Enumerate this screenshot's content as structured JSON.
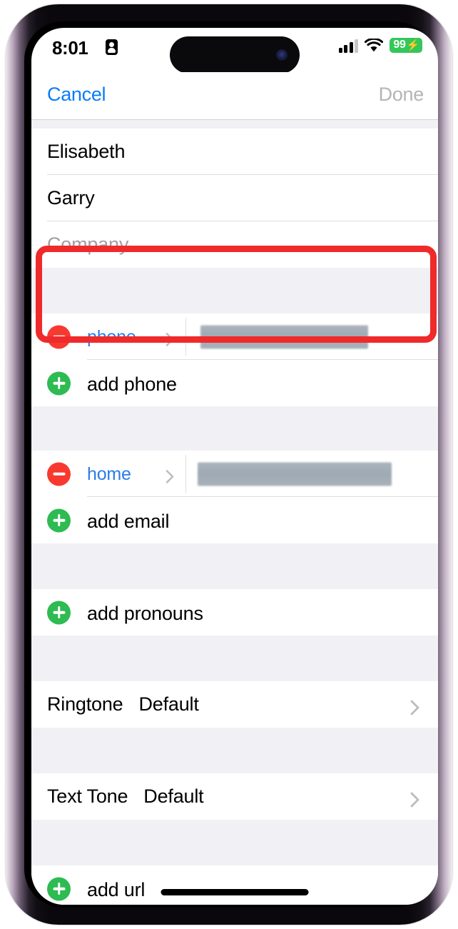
{
  "status_bar": {
    "time": "8:01",
    "id_icon": "contact-card-icon",
    "signal_icon": "cellular-signal-icon",
    "wifi_icon": "wifi-icon",
    "battery_level": "99",
    "battery_charging_glyph": "⚡",
    "battery_color": "#34c759"
  },
  "nav": {
    "cancel_label": "Cancel",
    "done_label": "Done",
    "cancel_color": "#0a7cf6",
    "done_color": "#b4b4b8"
  },
  "name_section": {
    "first_name": "Elisabeth",
    "last_name": "Garry",
    "company_placeholder": "Company"
  },
  "phone_section": {
    "entry_label": "phone",
    "entry_value_redacted": "",
    "add_label": "add phone",
    "remove_icon": "minus-circle-icon",
    "add_icon": "plus-circle-icon",
    "disclosure_icon": "chevron-right-icon",
    "highlighted": true,
    "highlight_color": "#ef2a2a"
  },
  "email_section": {
    "entry_label": "home",
    "entry_value_redacted": "",
    "add_label": "add email",
    "remove_icon": "minus-circle-icon",
    "add_icon": "plus-circle-icon",
    "disclosure_icon": "chevron-right-icon"
  },
  "pronouns_section": {
    "add_label": "add pronouns",
    "add_icon": "plus-circle-icon"
  },
  "ringtone_row": {
    "label": "Ringtone",
    "value": "Default",
    "disclosure_icon": "chevron-right-icon"
  },
  "texttone_row": {
    "label": "Text Tone",
    "value": "Default",
    "disclosure_icon": "chevron-right-icon"
  },
  "url_section": {
    "add_label": "add url",
    "add_icon": "plus-circle-icon"
  },
  "colors": {
    "ios_blue": "#0a7cf6",
    "label_blue": "#2a7ce8",
    "minus_red": "#f8392f",
    "plus_green": "#2dbb52",
    "group_bg": "#f1f1f5",
    "separator": "#dedee2",
    "redaction": "#a5afb8"
  }
}
